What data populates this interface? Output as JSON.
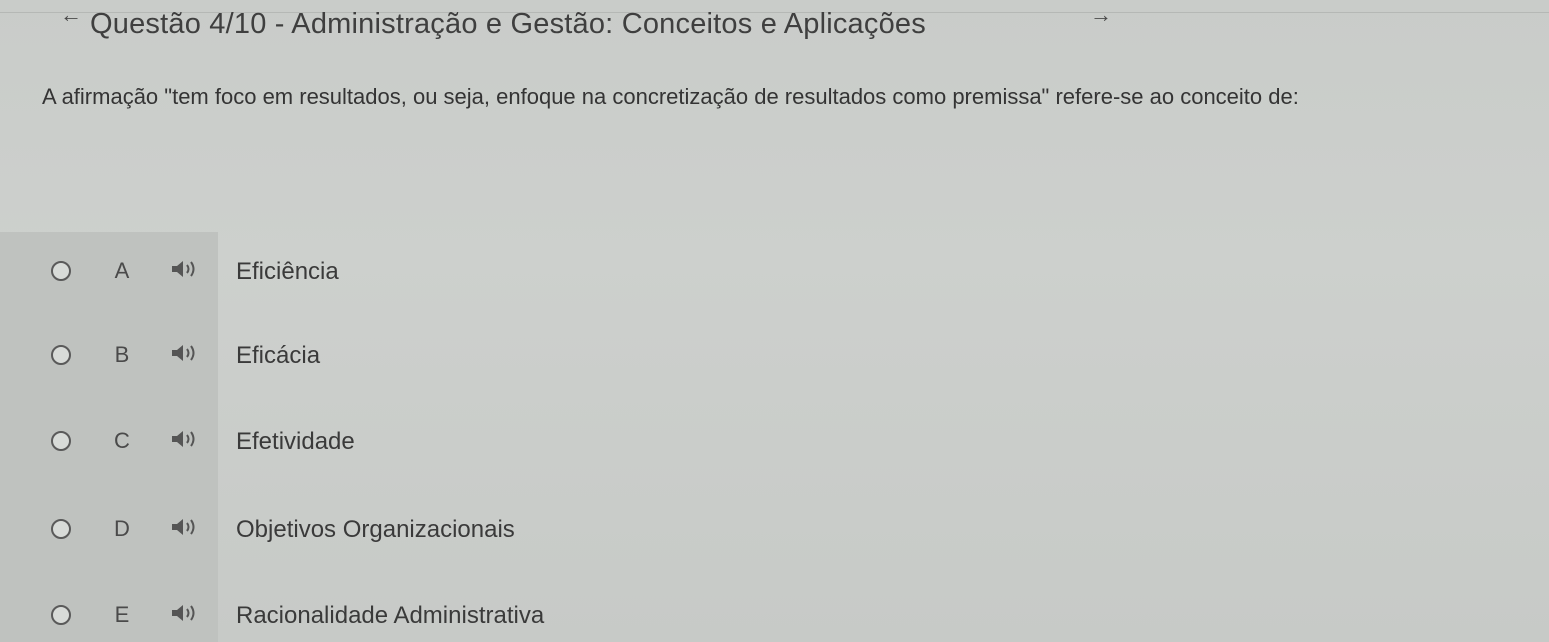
{
  "header": {
    "title": "Questão 4/10 - Administração e Gestão: Conceitos e Aplicações",
    "prev_icon": "arrow-left-icon",
    "next_icon": "arrow-right-icon"
  },
  "question": {
    "text": "A afirmação \"tem foco em resultados, ou seja, enfoque na concretização de resultados como premissa\" refere-se ao conceito de:"
  },
  "options": [
    {
      "letter": "A",
      "text": "Eficiência"
    },
    {
      "letter": "B",
      "text": "Eficácia"
    },
    {
      "letter": "C",
      "text": "Efetividade"
    },
    {
      "letter": "D",
      "text": "Objetivos Organizacionais"
    },
    {
      "letter": "E",
      "text": "Racionalidade Administrativa"
    }
  ],
  "icons": {
    "audio": "speaker-icon",
    "radio": "radio-button"
  }
}
